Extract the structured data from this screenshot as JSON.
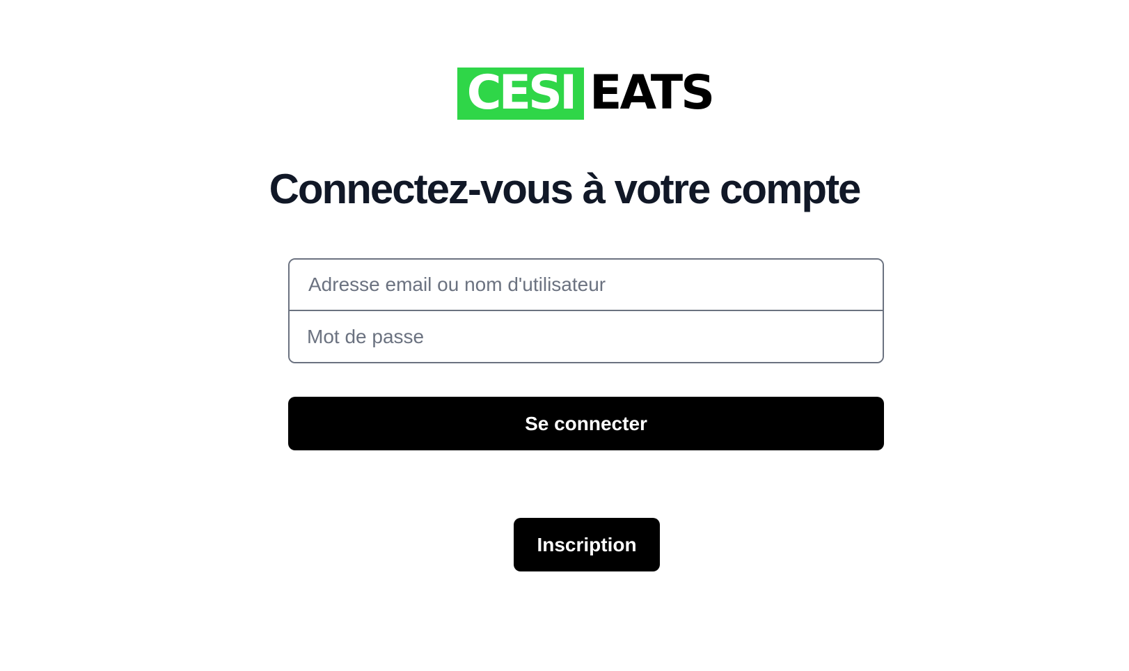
{
  "logo": {
    "part1": "CESI",
    "part2": "EATS",
    "brand_color": "#2fd648"
  },
  "title": "Connectez-vous à votre compte",
  "form": {
    "email_placeholder": "Adresse email ou nom d'utilisateur",
    "email_value": "",
    "password_placeholder": "Mot de passe",
    "password_value": "",
    "submit_label": "Se connecter"
  },
  "signup": {
    "label": "Inscription"
  },
  "colors": {
    "button_bg": "#000000",
    "title_text": "#111827",
    "placeholder_text": "#6b7280",
    "field_border": "#6b7280"
  }
}
